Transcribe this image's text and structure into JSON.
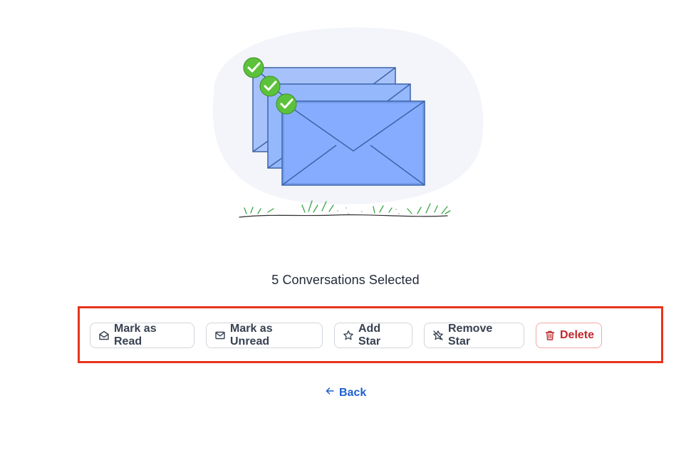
{
  "selection": {
    "title": "5 Conversations Selected"
  },
  "actions": {
    "mark_read": "Mark as Read",
    "mark_unread": "Mark as Unread",
    "add_star": "Add Star",
    "remove_star": "Remove Star",
    "delete": "Delete"
  },
  "navigation": {
    "back": "Back"
  },
  "icons": {
    "mark_read": "envelope-open-icon",
    "mark_unread": "envelope-icon",
    "add_star": "star-icon",
    "remove_star": "star-off-icon",
    "delete": "trash-icon",
    "back": "arrow-left-icon"
  },
  "colors": {
    "highlight_border": "#e8341c",
    "delete_text": "#c0282d",
    "back_link": "#1d5fd1",
    "envelope_fill": "#86acff",
    "check_green": "#5cc23b"
  }
}
